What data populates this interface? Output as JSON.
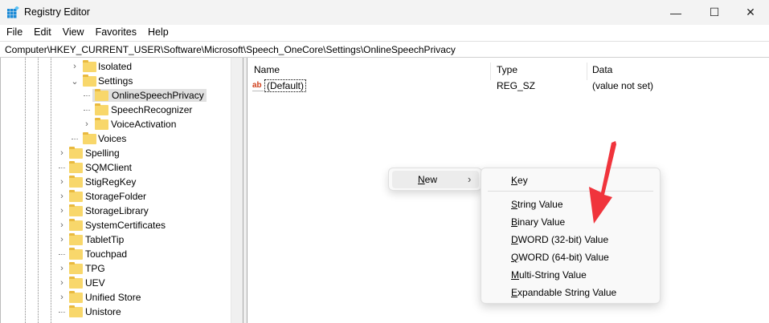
{
  "window": {
    "title": "Registry Editor",
    "minimize": "—",
    "maximize": "☐",
    "close": "✕"
  },
  "menubar": [
    "File",
    "Edit",
    "View",
    "Favorites",
    "Help"
  ],
  "address": "Computer\\HKEY_CURRENT_USER\\Software\\Microsoft\\Speech_OneCore\\Settings\\OnlineSpeechPrivacy",
  "tree": [
    {
      "label": "Isolated",
      "level": 1,
      "chev": "›"
    },
    {
      "label": "Settings",
      "level": 1,
      "chev": "⌄"
    },
    {
      "label": "OnlineSpeechPrivacy",
      "level": 2,
      "chev": "",
      "selected": true
    },
    {
      "label": "SpeechRecognizer",
      "level": 2,
      "chev": ""
    },
    {
      "label": "VoiceActivation",
      "level": 2,
      "chev": "›"
    },
    {
      "label": "Voices",
      "level": 1,
      "chev": ""
    },
    {
      "label": "Spelling",
      "level": 0,
      "chev": "›"
    },
    {
      "label": "SQMClient",
      "level": 0,
      "chev": ""
    },
    {
      "label": "StigRegKey",
      "level": 0,
      "chev": "›"
    },
    {
      "label": "StorageFolder",
      "level": 0,
      "chev": "›"
    },
    {
      "label": "StorageLibrary",
      "level": 0,
      "chev": "›"
    },
    {
      "label": "SystemCertificates",
      "level": 0,
      "chev": "›"
    },
    {
      "label": "TabletTip",
      "level": 0,
      "chev": "›"
    },
    {
      "label": "Touchpad",
      "level": 0,
      "chev": ""
    },
    {
      "label": "TPG",
      "level": 0,
      "chev": "›"
    },
    {
      "label": "UEV",
      "level": 0,
      "chev": "›"
    },
    {
      "label": "Unified Store",
      "level": 0,
      "chev": "›"
    },
    {
      "label": "Unistore",
      "level": 0,
      "chev": ""
    }
  ],
  "list": {
    "headers": {
      "name": "Name",
      "type": "Type",
      "data": "Data"
    },
    "rows": [
      {
        "name": "(Default)",
        "type": "REG_SZ",
        "data": "(value not set)"
      }
    ]
  },
  "context_menu": {
    "new": {
      "k": "N",
      "rest": "ew"
    },
    "arrow": "›"
  },
  "submenu": [
    {
      "k": "K",
      "rest": "ey"
    },
    {
      "k": "S",
      "rest": "tring Value"
    },
    {
      "k": "B",
      "rest": "inary Value"
    },
    {
      "k": "D",
      "rest": "WORD (32-bit) Value"
    },
    {
      "k": "Q",
      "rest": "WORD (64-bit) Value"
    },
    {
      "k": "M",
      "rest": "ulti-String Value"
    },
    {
      "k": "E",
      "rest": "xpandable String Value"
    }
  ],
  "colors": {
    "arrow": "#f0343c",
    "folder": "#f8d76b"
  }
}
